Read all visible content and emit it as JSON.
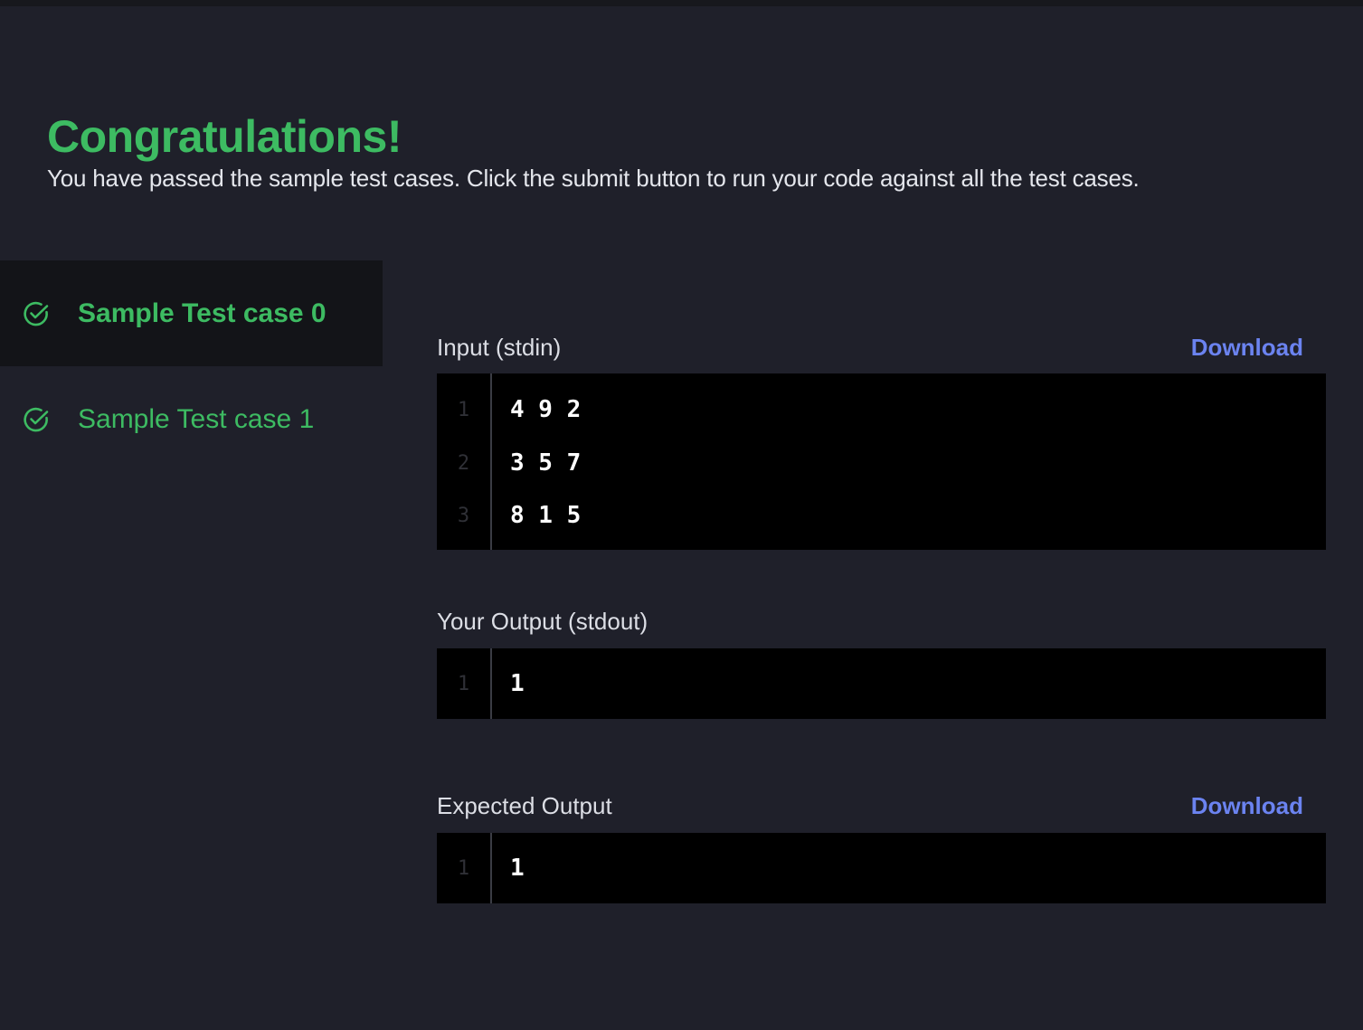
{
  "result": {
    "title": "Congratulations!",
    "message": "You have passed the sample test cases. Click the submit button to run your code against all the test cases."
  },
  "test_cases": [
    {
      "label": "Sample Test case 0",
      "status": "passed",
      "active": true
    },
    {
      "label": "Sample Test case 1",
      "status": "passed",
      "active": false
    }
  ],
  "input": {
    "label": "Input (stdin)",
    "download_label": "Download",
    "lines": [
      {
        "num": "1",
        "text": "4 9 2"
      },
      {
        "num": "2",
        "text": "3 5 7"
      },
      {
        "num": "3",
        "text": "8 1 5"
      }
    ]
  },
  "your_output": {
    "label": "Your Output (stdout)",
    "lines": [
      {
        "num": "1",
        "text": "1"
      }
    ]
  },
  "expected_output": {
    "label": "Expected Output",
    "download_label": "Download",
    "lines": [
      {
        "num": "1",
        "text": "1"
      }
    ]
  },
  "colors": {
    "success": "#3dbb62",
    "link": "#6b83f0",
    "background": "#1f202a"
  }
}
